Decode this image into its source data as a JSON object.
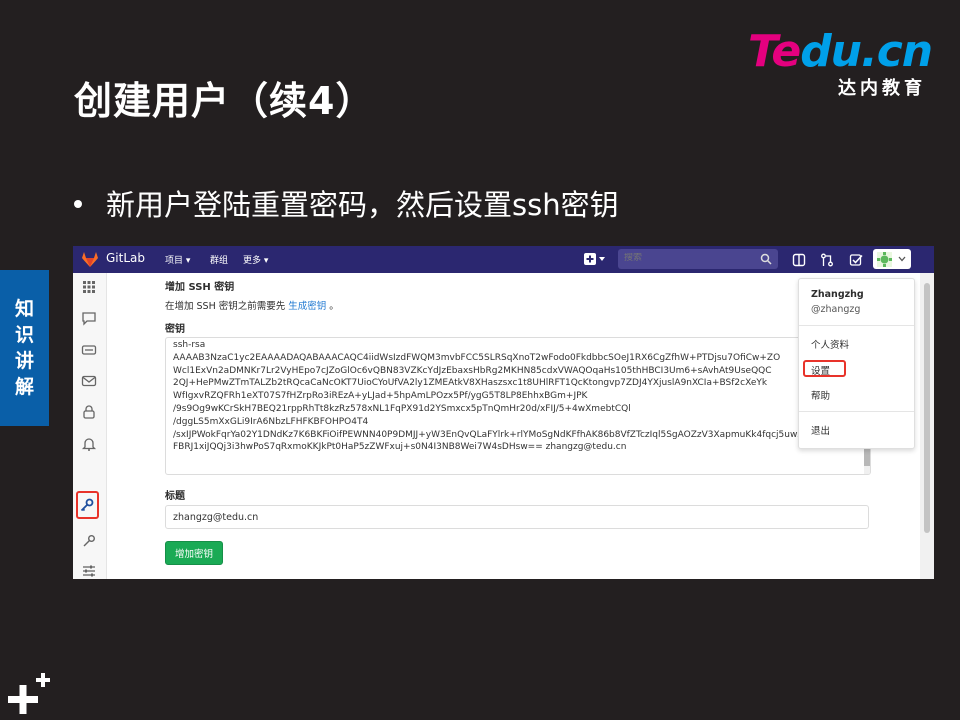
{
  "slide": {
    "title": "创建用户（续4）",
    "bullet": "新用户登陆重置密码，然后设置ssh密钥",
    "side_tab": [
      "知",
      "识",
      "讲",
      "解"
    ],
    "logo_word_1": "Te",
    "logo_word_2": "du.cn",
    "logo_sub": "达内教育"
  },
  "gitlab": {
    "brand": "GitLab",
    "nav": {
      "projects": "项目 ▾",
      "groups": "群组",
      "more": "更多 ▾"
    },
    "search_placeholder": "搜索",
    "section_title": "增加 SSH 密钥",
    "section_desc_prefix": "在增加 SSH 密钥之前需要先 ",
    "section_desc_link": "生成密钥",
    "section_desc_suffix": " 。",
    "key_label": "密钥",
    "key_value": "ssh-rsa\nAAAAB3NzaC1yc2EAAAADAQABAAACAQC4iidWsIzdFWQM3mvbFCC5SLRSqXnoT2wFodo0FkdbbcSOeJ1RX6CgZfhW+PTDjsu7OfiCw+ZO\nWcl1ExVn2aDMNKr7Lr2VyHEpo7cJZoGlOc6vQBN83VZKcYdJzEbaxsHbRg2MKHN85cdxVWAQOqaHs105thHBCI3Um6+sAvhAt9UseQQC\n2QJ+HePMwZTmTALZb2tRQcaCaNcOKT7UioCYoUfVA2ly1ZMEAtkV8XHaszsxc1t8UHlRFT1QcKtongvp7ZDJ4YXjuslA9nXCIa+BSf2cXeYk\nWfIgxvRZQFRh1eXT07S7fHZrpRo3iREzA+yLJad+5hpAmLPOzx5Pf/ygG5T8LP8EhhxBGm+JPK\n/9s9Og9wKCrSkH7BEQ21rppRhTt8kzRz578xNL1FqPX91d2YSmxcx5pTnQmHr20d/xFIJ/5+4wXmebtCQl\n/dggLS5mXxGLi9IrA6NbzLFHFKBFOHPO4T4\n/sxIJPWokFqrYa02Y1DNdKz7K6BKFiOifPEWNN40P9DMJJ+yW3EnQvQLaFYlrk+rlYMoSgNdKFfhAK86b8VfZTczIql5SgAOZzV3XapmuKk4fqcj5uwx5y\nFBRJ1xiJQQj3i3hwPoS7qRxmoKKJkPt0HaP5zZWFxuj+s0N4I3NB8Wei7W4sDHsw== zhangzg@tedu.cn",
    "title_label": "标题",
    "title_value": "zhangzg@tedu.cn",
    "add_button": "增加密钥",
    "dropdown": {
      "name": "Zhangzhg",
      "handle": "@zhangzg",
      "profile": "个人资料",
      "settings": "设置",
      "help": "帮助",
      "signout": "退出"
    }
  },
  "colors": {
    "slide_bg": "#231f20",
    "gitlab_nav": "#2b2770",
    "accent_blue": "#0a5fa8",
    "highlight_red": "#e8332a",
    "button_green": "#1aaa55"
  }
}
